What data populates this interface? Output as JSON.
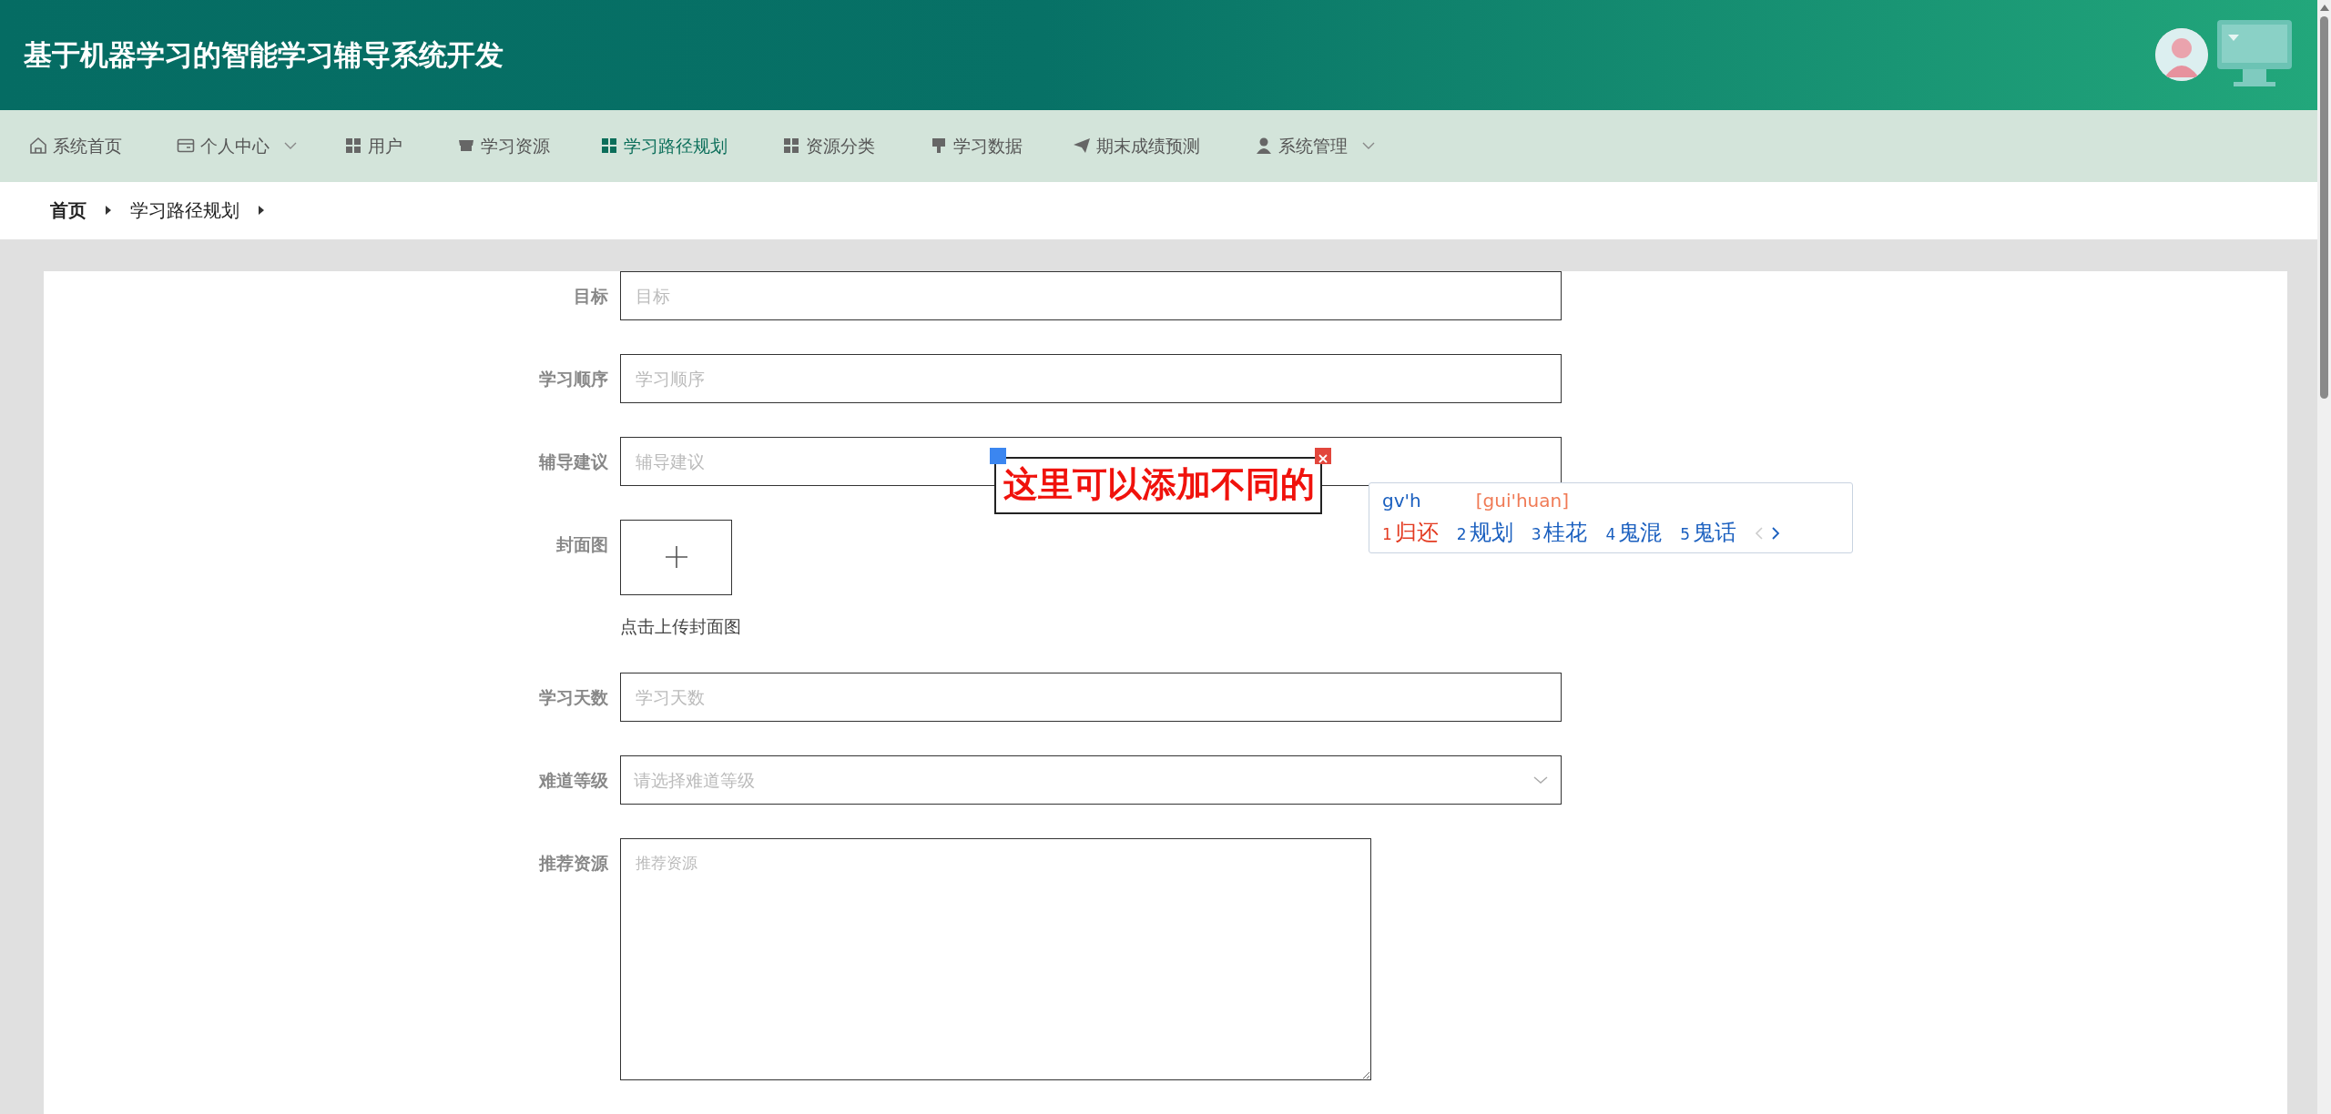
{
  "header": {
    "title": "基于机器学习的智能学习辅导系统开发"
  },
  "nav": {
    "items": [
      {
        "label": "系统首页",
        "selected": false,
        "dropdown": false
      },
      {
        "label": "个人中心",
        "selected": false,
        "dropdown": true
      },
      {
        "label": "用户",
        "selected": false,
        "dropdown": false
      },
      {
        "label": "学习资源",
        "selected": false,
        "dropdown": false
      },
      {
        "label": "学习路径规划",
        "selected": true,
        "dropdown": false
      },
      {
        "label": "资源分类",
        "selected": false,
        "dropdown": false
      },
      {
        "label": "学习数据",
        "selected": false,
        "dropdown": false
      },
      {
        "label": "期末成绩预测",
        "selected": false,
        "dropdown": false
      },
      {
        "label": "系统管理",
        "selected": false,
        "dropdown": true
      }
    ]
  },
  "breadcrumb": [
    {
      "label": "首页",
      "current": false
    },
    {
      "label": "学习路径规划",
      "current": true
    }
  ],
  "form": {
    "fields": [
      {
        "kind": "text",
        "label": "目标",
        "placeholder": "目标"
      },
      {
        "kind": "text",
        "label": "学习顺序",
        "placeholder": "学习顺序"
      },
      {
        "kind": "text",
        "label": "辅导建议",
        "placeholder": "辅导建议"
      },
      {
        "kind": "upload",
        "label": "封面图",
        "hint": "点击上传封面图"
      },
      {
        "kind": "text",
        "label": "学习天数",
        "placeholder": "学习天数"
      },
      {
        "kind": "select",
        "label": "难道等级",
        "placeholder": "请选择难道等级"
      },
      {
        "kind": "textarea",
        "label": "推荐资源",
        "placeholder": "推荐资源"
      }
    ]
  },
  "annotation": {
    "text": "这里可以添加不同的"
  },
  "ime": {
    "input": "gv'h",
    "pinyin": "[gui'huan]",
    "candidates": [
      {
        "index": "1",
        "text": "归还",
        "selected": true
      },
      {
        "index": "2",
        "text": "规划",
        "selected": false
      },
      {
        "index": "3",
        "text": "桂花",
        "selected": false
      },
      {
        "index": "4",
        "text": "鬼混",
        "selected": false
      },
      {
        "index": "5",
        "text": "鬼话",
        "selected": false
      }
    ]
  }
}
